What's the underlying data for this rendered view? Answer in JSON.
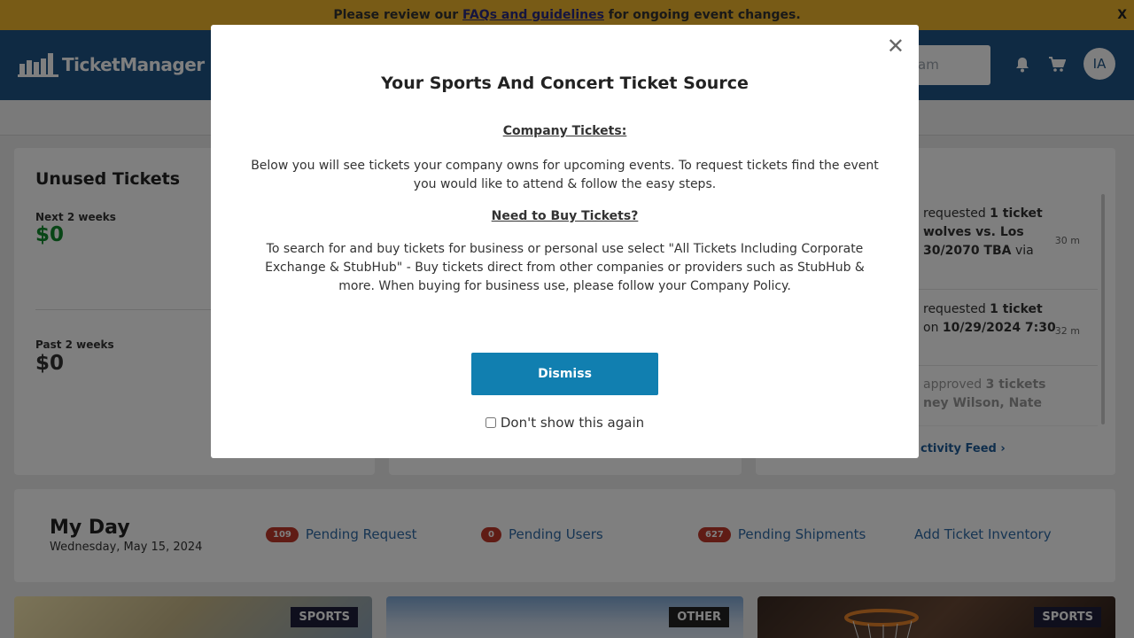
{
  "announcement": {
    "prefix": "Please review our",
    "link": "FAQs and guidelines",
    "suffix": "for ongoing event changes.",
    "close": "X"
  },
  "header": {
    "logo_text": "TicketManager",
    "search_placeholder": "am",
    "avatar_initials": "IA"
  },
  "unused_tickets": {
    "title": "Unused Tickets",
    "next_label": "Next 2 weeks",
    "next_value": "$0",
    "past_label": "Past 2 weeks",
    "past_value": "$0"
  },
  "activity_feed": {
    "items": [
      {
        "text_a": "requested",
        "text_b": "1 ticket",
        "text_c": "wolves vs. Los",
        "text_d": "30/2070 TBA",
        "text_e": "via",
        "time": "30 m"
      },
      {
        "text_a": "requested",
        "text_b": "1 ticket",
        "text_c": "on",
        "text_d": "10/29/2024 7:30",
        "time": "32 m"
      },
      {
        "text_a": "approved",
        "text_b": "3 tickets",
        "text_c": "ney Wilson, Nate",
        "time": ""
      }
    ],
    "link": "ctivity Feed ›"
  },
  "my_day": {
    "title": "My Day",
    "date": "Wednesday, May 15, 2024",
    "pending_request_count": "109",
    "pending_request_label": "Pending Request",
    "pending_users_count": "0",
    "pending_users_label": "Pending Users",
    "pending_shipments_count": "627",
    "pending_shipments_label": "Pending Shipments",
    "add_inventory_label": "Add Ticket Inventory"
  },
  "tiles": [
    {
      "tag": "SPORTS"
    },
    {
      "tag": "OTHER"
    },
    {
      "tag": "SPORTS"
    }
  ],
  "modal": {
    "title": "Your Sports And Concert Ticket Source",
    "company_heading": "Company Tickets:",
    "company_text_1": "Below you will see tickets your company owns for upcoming events.  To request tickets find the event",
    "company_text_2": "you would like to attend & follow the easy steps.",
    "buy_heading": "Need to Buy Tickets?",
    "buy_text_1": "To search for and buy tickets for business or personal use select \"All Tickets Including Corporate",
    "buy_text_2": "Exchange & StubHub\" - Buy tickets direct from other companies or providers such as StubHub &",
    "buy_text_3": "more. When buying for business use, please follow your Company Policy.",
    "dismiss": "Dismiss",
    "dont_show": "Don't show this again"
  },
  "colors": {
    "announce_bg": "#f0b62c",
    "header_bg": "#1f5486",
    "primary_button": "#117fb0",
    "money_green": "#118a2c",
    "badge_red": "#c0392b"
  }
}
